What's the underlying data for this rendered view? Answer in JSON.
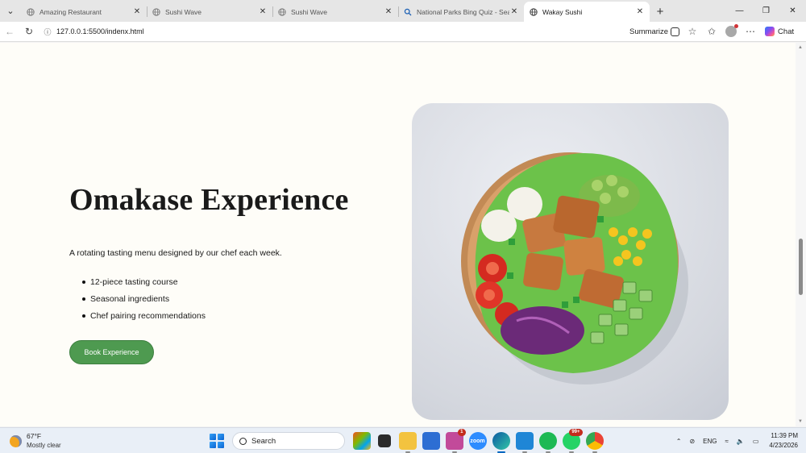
{
  "browser": {
    "tabs": [
      {
        "title": "Amazing Restaurant",
        "active": false,
        "favicon": "globe-icon"
      },
      {
        "title": "Sushi Wave",
        "active": false,
        "favicon": "globe-icon"
      },
      {
        "title": "Sushi Wave",
        "active": false,
        "favicon": "globe-icon"
      },
      {
        "title": "National Parks Bing Quiz - Search",
        "active": false,
        "favicon": "search-icon"
      },
      {
        "title": "Wakay Sushi",
        "active": true,
        "favicon": "globe-icon"
      }
    ],
    "url": "127.0.0.1:5500/indenx.html",
    "summarize_label": "Summarize",
    "chat_label": "Chat"
  },
  "page": {
    "title": "Omakase Experience",
    "description": "A rotating tasting menu designed by our chef each week.",
    "features": [
      "12-piece tasting course",
      "Seasonal ingredients",
      "Chef pairing recommendations"
    ],
    "cta_label": "Book Experience",
    "button_color": "#4e9a50",
    "background_color": "#fefdf8"
  },
  "taskbar": {
    "weather": {
      "temp": "67°F",
      "condition": "Mostly clear"
    },
    "search_label": "Search",
    "badges": {
      "teams": "1",
      "whatsapp": "99+"
    },
    "language": "ENG",
    "time": "11:39 PM",
    "date": "4/23/2026"
  }
}
